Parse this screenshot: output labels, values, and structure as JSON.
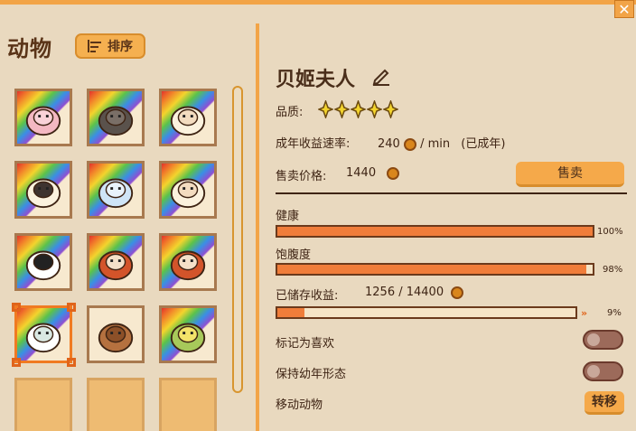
{
  "window": {
    "close_label": "✕"
  },
  "left_panel": {
    "title": "动物",
    "sort_label": "排序",
    "animals": [
      {
        "name": "pink-sheep",
        "body": "#f4b8c2",
        "face": "#f9d2d8",
        "rainbow": true
      },
      {
        "name": "black-sheep",
        "body": "#5a524c",
        "face": "#7a6f67",
        "rainbow": true
      },
      {
        "name": "white-sheep",
        "body": "#fbf2de",
        "face": "#f3dcc0",
        "rainbow": true
      },
      {
        "name": "black-face-sheep",
        "body": "#fbf2de",
        "face": "#3e3430",
        "rainbow": true
      },
      {
        "name": "blue-sheep",
        "body": "#cfe5f7",
        "face": "#e9f3fb",
        "rainbow": true
      },
      {
        "name": "cream-sheep",
        "body": "#fbf2de",
        "face": "#f3dcc0",
        "rainbow": true
      },
      {
        "name": "panda",
        "body": "#ffffff",
        "face": "#222222",
        "rainbow": true
      },
      {
        "name": "red-panda",
        "body": "#d3542a",
        "face": "#f4e0c8",
        "rainbow": true
      },
      {
        "name": "red-panda-2",
        "body": "#d3542a",
        "face": "#f4e0c8",
        "rainbow": true
      },
      {
        "name": "white-cat",
        "body": "#ffffff",
        "face": "#d9e8e2",
        "rainbow": true
      },
      {
        "name": "capybara",
        "body": "#b5713f",
        "face": "#8c5028",
        "rainbow": false
      },
      {
        "name": "parakeet",
        "body": "#a7c95a",
        "face": "#f3e36a",
        "rainbow": true
      }
    ]
  },
  "detail": {
    "name": "贝姬夫人",
    "quality_label": "品质:",
    "quality_stars": 5,
    "income_label": "成年收益速率:",
    "income_value": "240",
    "income_unit": "/ min",
    "income_status": "(已成年)",
    "price_label": "售卖价格:",
    "price_value": "1440",
    "sell_label": "售卖",
    "health_label": "健康",
    "health_pct": 100,
    "health_text": "100%",
    "fullness_label": "饱腹度",
    "fullness_pct": 98,
    "fullness_text": "98%",
    "stored_label": "已储存收益:",
    "stored_value": "1256 / 14400",
    "stored_pct": 9,
    "stored_text": "9%",
    "favorite_label": "标记为喜欢",
    "keep_young_label": "保持幼年形态",
    "move_label": "移动动物",
    "move_btn": "转移"
  },
  "colors": {
    "accent": "#f2a447",
    "bar_fill": "#f07d3a",
    "star": "#f3d42d"
  }
}
